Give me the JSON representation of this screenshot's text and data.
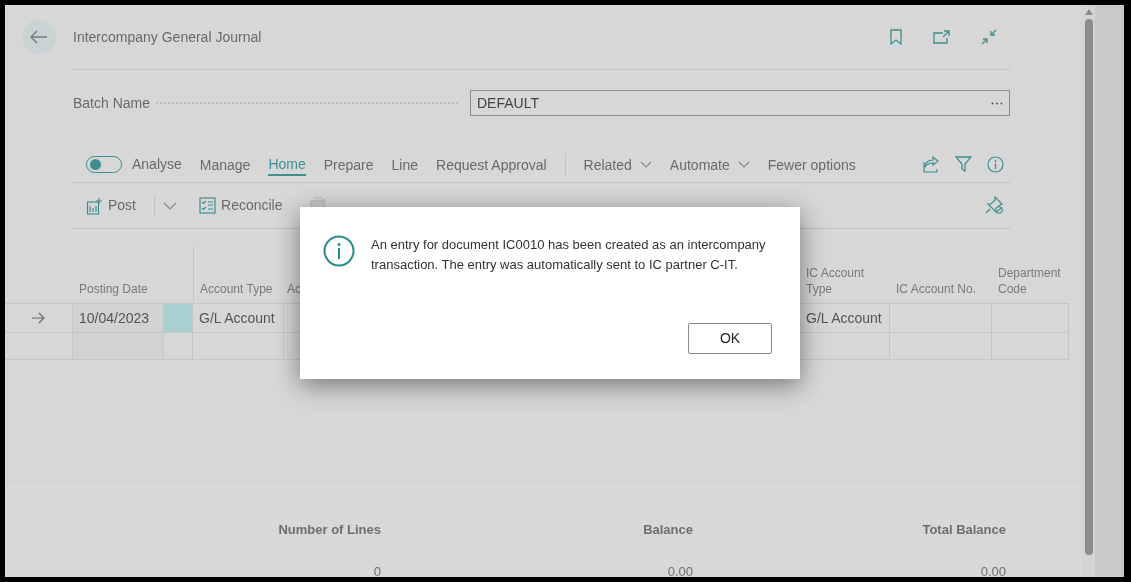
{
  "page": {
    "title": "Intercompany General Journal"
  },
  "batch": {
    "label": "Batch Name",
    "value": "DEFAULT"
  },
  "action_bar": {
    "analyse": {
      "label": "Analyse",
      "on": false
    },
    "tabs": [
      {
        "label": "Manage",
        "selected": false
      },
      {
        "label": "Home",
        "selected": true
      },
      {
        "label": "Prepare",
        "selected": false
      },
      {
        "label": "Line",
        "selected": false
      },
      {
        "label": "Request Approval",
        "selected": false
      }
    ],
    "menus": [
      {
        "label": "Related"
      },
      {
        "label": "Automate"
      }
    ],
    "fewer_options": "Fewer options"
  },
  "toolbar": [
    {
      "label": "Post",
      "kind": "split",
      "disabled": false
    },
    {
      "label": "Reconcile",
      "kind": "plain",
      "disabled": false
    },
    {
      "kind": "plain",
      "disabled": true
    }
  ],
  "table": {
    "columns": [
      "Posting Date",
      "",
      "Account Type",
      "Ac",
      "IC Account Type",
      "IC Account No.",
      "Department Code"
    ],
    "rows": [
      {
        "current": true,
        "cells": [
          "10/04/2023",
          "",
          "G/L Account",
          "",
          "G/L Account",
          "",
          ""
        ]
      },
      {
        "current": false,
        "cells": [
          "",
          "",
          "",
          "",
          "",
          "",
          ""
        ]
      }
    ]
  },
  "totals": [
    {
      "label": "Number of Lines",
      "value": "0"
    },
    {
      "label": "Balance",
      "value": "0.00"
    },
    {
      "label": "Total Balance",
      "value": "0.00"
    }
  ],
  "dialog": {
    "message": "An entry for document IC0010 has been created as an intercompany transaction. The entry was automatically sent to IC partner C-IT.",
    "button": "OK"
  }
}
